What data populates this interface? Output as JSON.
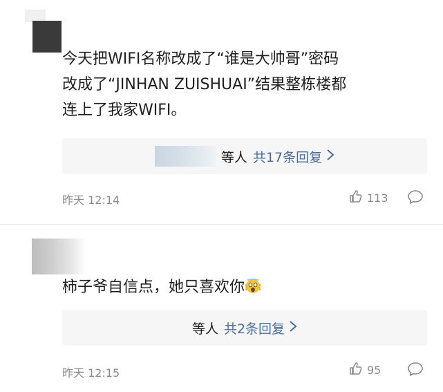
{
  "comments": [
    {
      "text_line1": "今天把WIFI名称改成了“谁是大帅哥”密码",
      "text_line2": "改成了“JINHAN ZUISHUAI”结果整栋楼都",
      "text_line3": "连上了我家WIFI。",
      "reply_who": "等人",
      "reply_count": "共17条回复",
      "time": "昨天 12:14",
      "likes": "113"
    },
    {
      "text": "柿子爷自信点，她只喜欢你",
      "emoji": "screaming-face-emoji",
      "reply_who": "等人",
      "reply_count": "共2条回复",
      "time": "昨天 12:15",
      "likes": "95"
    }
  ],
  "icons": {
    "like": "thumbs-up-icon",
    "comment": "speech-bubble-icon",
    "chevron": "chevron-right-icon"
  },
  "colors": {
    "link": "#4a6c9a",
    "meta": "#8a8a8a",
    "reply_bg": "#f6f6f6"
  }
}
